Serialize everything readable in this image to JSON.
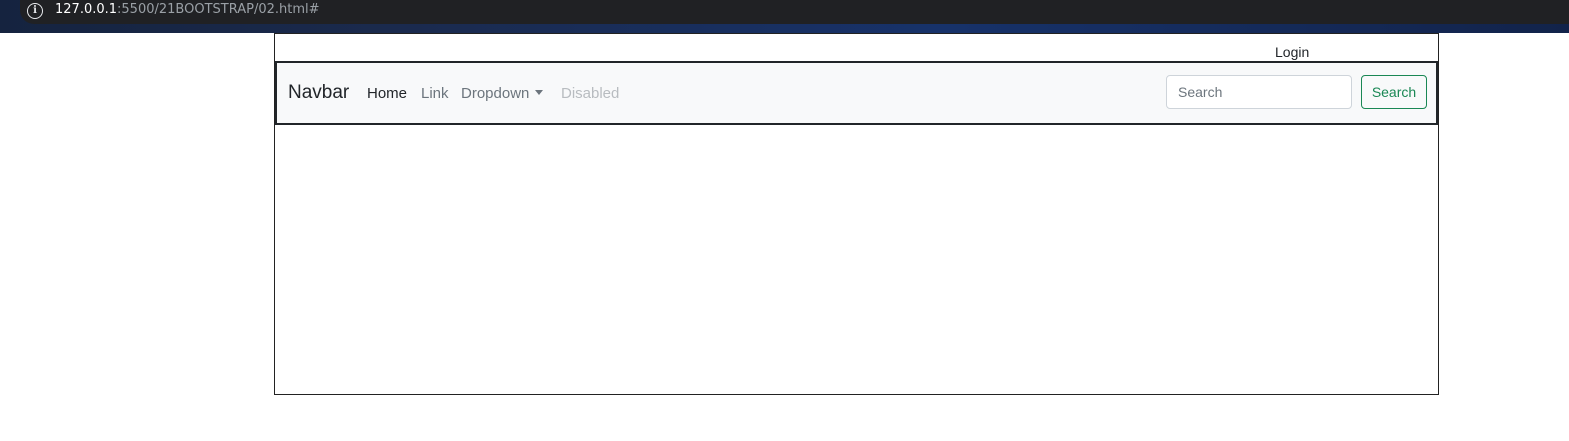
{
  "browser": {
    "url_host": "127.0.0.1",
    "url_rest": ":5500/21BOOTSTRAP/02.html#",
    "info_icon": "info-icon"
  },
  "page": {
    "login_label": "Login"
  },
  "navbar": {
    "brand": "Navbar",
    "items": [
      {
        "label": "Home",
        "state": "active"
      },
      {
        "label": "Link",
        "state": "normal"
      },
      {
        "label": "Dropdown",
        "state": "dropdown"
      },
      {
        "label": "Disabled",
        "state": "disabled"
      }
    ],
    "search": {
      "placeholder": "Search",
      "value": "",
      "button_label": "Search"
    }
  },
  "colors": {
    "navbar_bg": "#f8f9fa",
    "success": "#198754",
    "muted": "#6c757d",
    "disabled": "#b8bcc0"
  }
}
